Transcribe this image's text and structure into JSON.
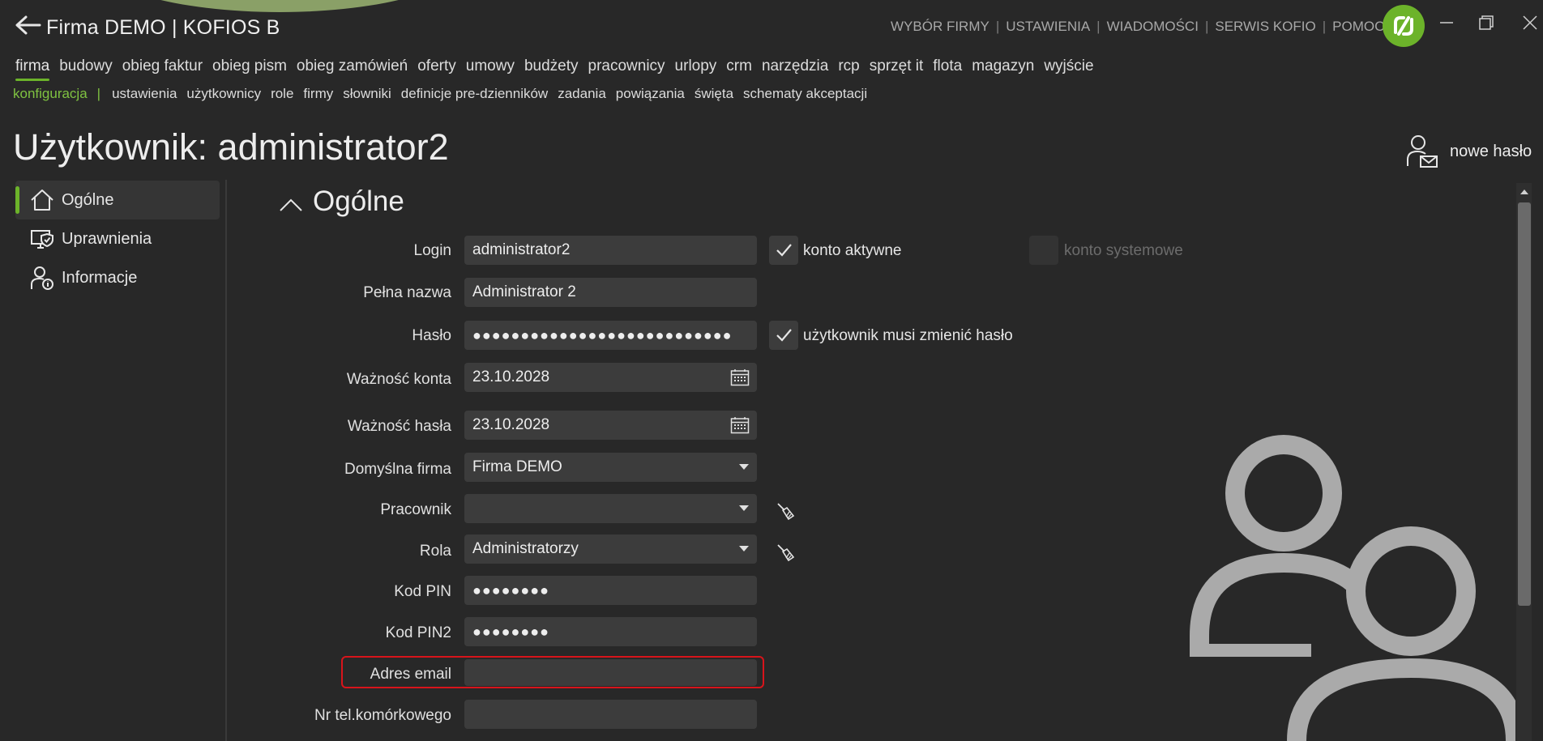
{
  "app": {
    "title": "Firma DEMO | KOFIOS B",
    "top_menu": [
      "WYBÓR FIRMY",
      "USTAWIENIA",
      "WIADOMOŚCI",
      "SERWIS KOFIO",
      "POMOC"
    ],
    "accent_color": "#6cb32a"
  },
  "nav_primary": [
    "firma",
    "budowy",
    "obieg faktur",
    "obieg pism",
    "obieg zamówień",
    "oferty",
    "umowy",
    "budżety",
    "pracownicy",
    "urlopy",
    "crm",
    "narzędzia",
    "rcp",
    "sprzęt it",
    "flota",
    "magazyn",
    "wyjście"
  ],
  "nav_secondary": {
    "active": "konfiguracja",
    "separator": "|",
    "items": [
      "ustawienia",
      "użytkownicy",
      "role",
      "firmy",
      "słowniki",
      "definicje pre-dzienników",
      "zadania",
      "powiązania",
      "święta",
      "schematy akceptacji"
    ]
  },
  "page": {
    "title": "Użytkownik: administrator2",
    "new_password_label": "nowe hasło"
  },
  "sidebar": [
    {
      "label": "Ogólne",
      "icon": "home-icon",
      "selected": true
    },
    {
      "label": "Uprawnienia",
      "icon": "monitor-shield-icon",
      "selected": false
    },
    {
      "label": "Informacje",
      "icon": "user-info-icon",
      "selected": false
    }
  ],
  "section": {
    "title": "Ogólne"
  },
  "form": {
    "login": {
      "label": "Login",
      "value": "administrator2"
    },
    "full_name": {
      "label": "Pełna nazwa",
      "value": "Administrator 2"
    },
    "password": {
      "label": "Hasło",
      "value": "●●●●●●●●●●●●●●●●●●●●●●●●●●●"
    },
    "account_validity": {
      "label": "Ważność konta",
      "value": "23.10.2028"
    },
    "password_validity": {
      "label": "Ważność hasła",
      "value": "23.10.2028"
    },
    "default_company": {
      "label": "Domyślna firma",
      "value": "Firma DEMO"
    },
    "employee": {
      "label": "Pracownik",
      "value": ""
    },
    "role": {
      "label": "Rola",
      "value": "Administratorzy"
    },
    "pin": {
      "label": "Kod PIN",
      "value": "●●●●●●●●"
    },
    "pin2": {
      "label": "Kod PIN2",
      "value": "●●●●●●●●"
    },
    "email": {
      "label": "Adres email",
      "value": ""
    },
    "mobile": {
      "label": "Nr tel.komórkowego",
      "value": ""
    },
    "account_active": {
      "label": "konto aktywne",
      "checked": true
    },
    "system_account": {
      "label": "konto systemowe",
      "checked": false,
      "disabled": true
    },
    "must_change_password": {
      "label": "użytkownik musi zmienić hasło",
      "checked": true
    }
  }
}
